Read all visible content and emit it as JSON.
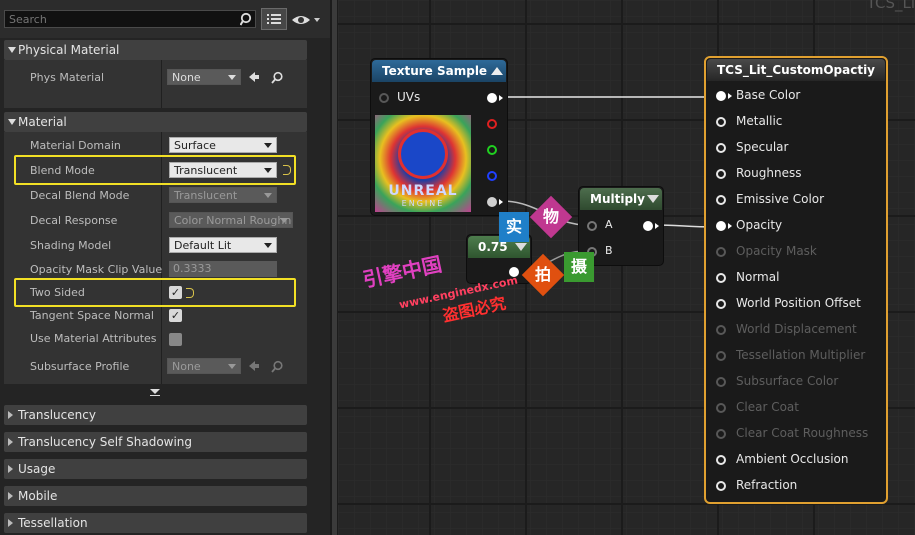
{
  "search": {
    "placeholder": "Search"
  },
  "icons": {
    "magnify": "magnifier-icon",
    "list_view": "list-view-icon",
    "eye": "eye-icon",
    "reset": "reset-arrow-icon",
    "use_asset": "arrow-left-icon",
    "browse": "search-icon"
  },
  "categories": {
    "physical_material": "Physical Material",
    "material": "Material",
    "translucency": "Translucency",
    "translucency_self_shadowing": "Translucency Self Shadowing",
    "usage": "Usage",
    "mobile": "Mobile",
    "tessellation": "Tessellation"
  },
  "physical": {
    "phys_material_label": "Phys Material",
    "phys_material_value": "None"
  },
  "material_props": {
    "domain_label": "Material Domain",
    "domain_value": "Surface",
    "blend_label": "Blend Mode",
    "blend_value": "Translucent",
    "decal_blend_label": "Decal Blend Mode",
    "decal_blend_value": "Translucent",
    "decal_response_label": "Decal Response",
    "decal_response_value": "Color Normal Roughness",
    "shading_label": "Shading Model",
    "shading_value": "Default Lit",
    "opacity_clip_label": "Opacity Mask Clip Value",
    "opacity_clip_value": "0.3333",
    "two_sided_label": "Two Sided",
    "two_sided_checked": true,
    "tangent_label": "Tangent Space Normal",
    "tangent_checked": true,
    "use_attr_label": "Use Material Attributes",
    "use_attr_checked": false,
    "subsurface_label": "Subsurface Profile",
    "subsurface_value": "None"
  },
  "graph": {
    "title": "TCS_Li",
    "texture_node": {
      "title": "Texture Sample",
      "uv_label": "UVs",
      "preview_text": "UNREAL",
      "preview_subtext": "ENGINE",
      "output_colors": [
        "#ffffff",
        "#e02020",
        "#20d020",
        "#2040ff",
        "#d0d0d0"
      ]
    },
    "multiply_node": {
      "title": "Multiply",
      "in_a": "A",
      "in_b": "B"
    },
    "constant_node": {
      "value": "0.75"
    },
    "result_node": {
      "title": "TCS_Lit_CustomOpactiу",
      "pins": [
        {
          "label": "Base Color",
          "active": true,
          "connected": true
        },
        {
          "label": "Metallic",
          "active": true,
          "connected": false
        },
        {
          "label": "Specular",
          "active": true,
          "connected": false
        },
        {
          "label": "Roughness",
          "active": true,
          "connected": false
        },
        {
          "label": "Emissive Color",
          "active": true,
          "connected": false
        },
        {
          "label": "Opacity",
          "active": true,
          "connected": true
        },
        {
          "label": "Opacity Mask",
          "active": false,
          "connected": false
        },
        {
          "label": "Normal",
          "active": true,
          "connected": false
        },
        {
          "label": "World Position Offset",
          "active": true,
          "connected": false
        },
        {
          "label": "World Displacement",
          "active": false,
          "connected": false
        },
        {
          "label": "Tessellation Multiplier",
          "active": false,
          "connected": false
        },
        {
          "label": "Subsurface Color",
          "active": false,
          "connected": false
        },
        {
          "label": "Clear Coat",
          "active": false,
          "connected": false
        },
        {
          "label": "Clear Coat Roughness",
          "active": false,
          "connected": false
        },
        {
          "label": "Ambient Occlusion",
          "active": true,
          "connected": false
        },
        {
          "label": "Refraction",
          "active": true,
          "connected": false
        }
      ]
    }
  },
  "watermark": {
    "boxes": [
      "实",
      "物",
      "拍",
      "摄"
    ],
    "line1": "引擎中国",
    "line2": "www.enginedx.com",
    "line3": "盗图必究"
  },
  "colors": {
    "highlight": "#f2e025",
    "texture_head": "#1f4e72",
    "multiply_head": "#3a5a3a",
    "result_head": "#2c2c2c",
    "result_border": "#e0a030"
  }
}
